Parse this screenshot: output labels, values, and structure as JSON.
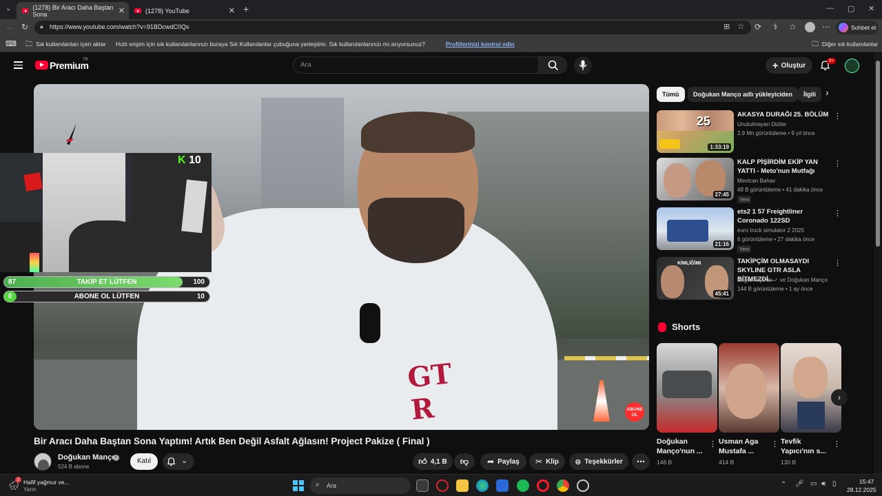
{
  "browser": {
    "tabs": [
      {
        "label": "(1278) Bir Aracı Daha Baştan Sona"
      },
      {
        "label": "(1278) YouTube"
      }
    ],
    "url": "https://www.youtube.com/watch?v=91BDcwdC0Qs",
    "chat_button": "Sohbet et",
    "bookmarks": {
      "import_label": "Sık kullanılanları içeri aktar",
      "hint": "Hızlı erişim için sık kullanılanlarınızı buraya Sık Kullanılanlar çubuğuna yerleştirin. Sık kullanılanlarınızı mı arıyorsunuz?",
      "link": "Profillerinizi kontrol edin",
      "other": "Diğer sık kullanılanlar"
    }
  },
  "header": {
    "logo": "Premium",
    "logo_region": "TR",
    "search_placeholder": "Ara",
    "create_label": "Oluştur",
    "notif_badge": "9+"
  },
  "overlay": {
    "kick_count": "10",
    "follow": {
      "label": "TAKİP ET LÜTFEN",
      "current": "87",
      "goal": "100",
      "progress": 0.87
    },
    "subscribe": {
      "label": "ABONE OL LÜTFEN",
      "current": "0",
      "goal": "10",
      "progress": 0.0
    }
  },
  "video": {
    "title": "Bir Aracı Daha Baştan Sona Yaptım! Artık Ben Değil Asfalt Ağlasın! Project Pakize ( Final )",
    "watermark": "ABONE OL",
    "channel": "Doğukan Manço",
    "subscribers": "524 B abone",
    "join_label": "Katıl",
    "likes": "4,1 B",
    "share_label": "Paylaş",
    "clip_label": "Klip",
    "thanks_label": "Teşekkürler"
  },
  "sidebar": {
    "chips": [
      "Tümü",
      "Doğukan Manço adlı yükleyiciden",
      "İlgili"
    ],
    "recommendations": [
      {
        "title": "AKASYA DURAĞI 25. BÖLÜM",
        "channel": "Unutulmayan Diziler",
        "meta": "2,9 Mn görüntüleme • 9 yıl önce",
        "duration": "1:33:19",
        "new": ""
      },
      {
        "title": "KALP PİŞİRDİM EKİP YAN YATTI - Meto'nun Mutfağı",
        "channel": "Mevtcan Bahav",
        "meta": "49 B görüntüleme • 41 dakika önce",
        "duration": "27:45",
        "new": "Yeni"
      },
      {
        "title": "ets2 1 57 Freightliner Coronado 122SD",
        "channel": "euro truck simulator 2 2025",
        "meta": "6 görüntüleme • 27 dakika önce",
        "duration": "21:16",
        "new": "Yeni"
      },
      {
        "title": "TAKİPÇİM OLMASAYDI SKYLINE GTR ASLA BİTMEZDİ...",
        "channel": "Buğra Akpınar ✓ ve Doğukan Manço",
        "meta": "144 B görüntüleme • 1 ay önce",
        "duration": "45:41",
        "new": ""
      }
    ],
    "shorts_label": "Shorts",
    "shorts": [
      {
        "title": "Doğukan Manço'nun ...",
        "views": "146 B"
      },
      {
        "title": "Usman Aga Mustafa ...",
        "views": "414 B"
      },
      {
        "title": "Tevfik Yapıcı'nın s...",
        "views": "130 B"
      }
    ]
  },
  "taskbar": {
    "weather_title": "Hafif yağmur ve...",
    "weather_sub": "Yarın",
    "weather_badge": "2",
    "search_placeholder": "Ara",
    "time": "15:47",
    "date": "28.12.2025"
  }
}
